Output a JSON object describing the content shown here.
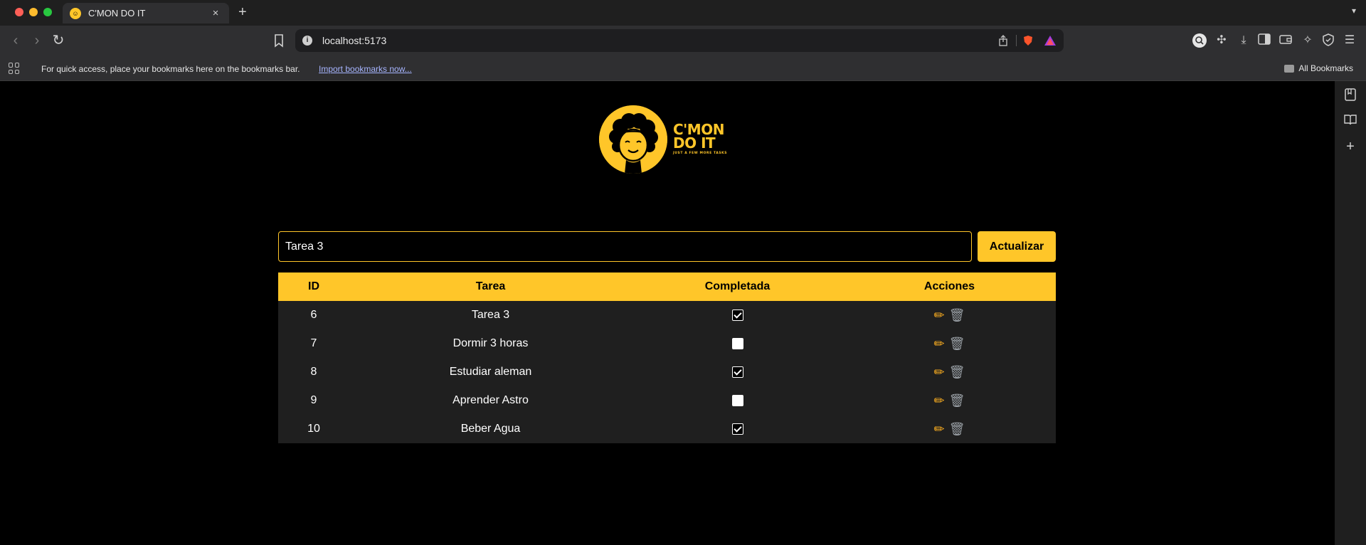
{
  "browser": {
    "tab_title": "C'MON DO IT",
    "tab_close": "×",
    "new_tab": "+",
    "url": "localhost:5173",
    "bookmarks_hint": "For quick access, place your bookmarks here on the bookmarks bar.",
    "import_link": "Import bookmarks now...",
    "all_bookmarks": "All Bookmarks"
  },
  "logo": {
    "line1": "C'MON",
    "line2": "DO IT",
    "tagline": "JUST A FEW MORE TASKS",
    "color": "#ffc629"
  },
  "form": {
    "input_value": "Tarea 3",
    "submit_label": "Actualizar"
  },
  "table": {
    "headers": [
      "ID",
      "Tarea",
      "Completada",
      "Acciones"
    ],
    "rows": [
      {
        "id": "6",
        "task": "Tarea 3",
        "completed": true
      },
      {
        "id": "7",
        "task": "Dormir 3 horas",
        "completed": false
      },
      {
        "id": "8",
        "task": "Estudiar aleman",
        "completed": true
      },
      {
        "id": "9",
        "task": "Aprender Astro",
        "completed": false
      },
      {
        "id": "10",
        "task": "Beber Agua",
        "completed": true
      }
    ],
    "action_icons": {
      "edit": "pencil-icon",
      "delete": "trash-icon"
    }
  },
  "theme": {
    "accent": "#ffc629",
    "background": "#000000",
    "row_background": "#1f1f1f"
  }
}
